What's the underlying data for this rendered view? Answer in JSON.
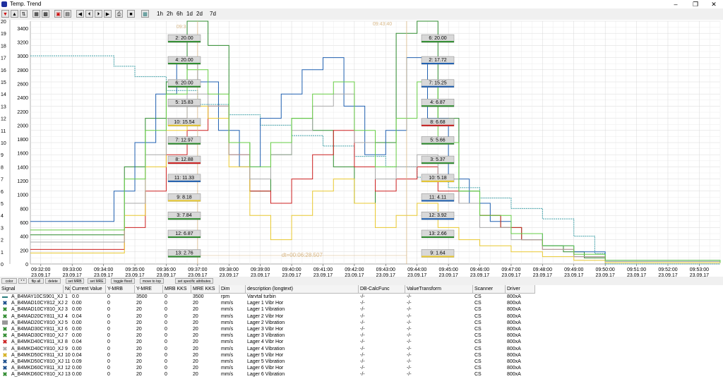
{
  "window": {
    "title": "Temp. Trend"
  },
  "toolbar": {
    "ranges": [
      "1h",
      "2h",
      "6h",
      "1d",
      "2d",
      "7d"
    ]
  },
  "chart_data": {
    "type": "line",
    "x_ticks": [
      {
        "time": "09:32:00",
        "date": "23.09.17"
      },
      {
        "time": "09:33:00",
        "date": "23.09.17"
      },
      {
        "time": "09:34:00",
        "date": "23.09.17"
      },
      {
        "time": "09:35:00",
        "date": "23.09.17"
      },
      {
        "time": "09:36:00",
        "date": "23.09.17"
      },
      {
        "time": "09:37:00",
        "date": "23.09.17"
      },
      {
        "time": "09:38:00",
        "date": "23.09.17"
      },
      {
        "time": "09:39:00",
        "date": "23.09.17"
      },
      {
        "time": "09:40:00",
        "date": "23.09.17"
      },
      {
        "time": "09:41:00",
        "date": "23.09.17"
      },
      {
        "time": "09:42:00",
        "date": "23.09.17"
      },
      {
        "time": "09:43:00",
        "date": "23.09.17"
      },
      {
        "time": "09:44:00",
        "date": "23.09.17"
      },
      {
        "time": "09:45:00",
        "date": "23.09.17"
      },
      {
        "time": "09:46:00",
        "date": "23.09.17"
      },
      {
        "time": "09:47:00",
        "date": "23.09.17"
      },
      {
        "time": "09:48:00",
        "date": "23.09.17"
      },
      {
        "time": "09:49:00",
        "date": "23.09.17"
      },
      {
        "time": "09:50:00",
        "date": "23.09.17"
      },
      {
        "time": "09:51:00",
        "date": "23.09.17"
      },
      {
        "time": "09:52:00",
        "date": "23.09.17"
      },
      {
        "time": "09:53:00",
        "date": "23.09.17"
      }
    ],
    "xlim": [
      "09:31:40",
      "09:53:40"
    ],
    "y_left_ticks": [
      "20",
      "19",
      "18",
      "17",
      "16",
      "15",
      "14",
      "13",
      "12",
      "11",
      "10",
      "9",
      "8",
      "7",
      "6",
      "5",
      "4",
      "3",
      "2",
      "1",
      "0"
    ],
    "y_left_lim": [
      0,
      20
    ],
    "y_right_ticks": [
      "3400",
      "3200",
      "3000",
      "2800",
      "2600",
      "2400",
      "2200",
      "2000",
      "1800",
      "1600",
      "1400",
      "1200",
      "1000",
      "800",
      "600",
      "400",
      "200",
      "0"
    ],
    "y_right_lim": [
      0,
      3500
    ],
    "grid": true,
    "cursor1": {
      "time": "09:37:00",
      "label": "09:3",
      "date_label": "23.09.17"
    },
    "cursor2": {
      "time": "09:43:40",
      "label": "09:43:40",
      "date_label": "23.09.17"
    },
    "delta_label": "dt=00:06:28.507",
    "cursor1_labels": [
      {
        "text": "2: 20.00",
        "color": "#2e8b2e",
        "value": 18.6
      },
      {
        "text": "4: 20.00",
        "color": "#2e8b2e",
        "value": 16.8
      },
      {
        "text": "6: 20.00",
        "color": "#2e8b2e",
        "value": 14.9
      },
      {
        "text": "5: 15.83",
        "color": "#aaaaaa",
        "value": 13.3
      },
      {
        "text": "10: 15.54",
        "color": "#e8c830",
        "value": 11.7
      },
      {
        "text": "7: 12.97",
        "color": "#2e8b2e",
        "value": 10.2
      },
      {
        "text": "8: 12.88",
        "color": "#cc2020",
        "value": 8.6
      },
      {
        "text": "11: 11.33",
        "color": "#2060b0",
        "value": 7.1
      },
      {
        "text": "9: 8.18",
        "color": "#e8c830",
        "value": 5.5
      },
      {
        "text": "3: 7.84",
        "color": "#2e8b2e",
        "value": 4.0
      },
      {
        "text": "12: 6.87",
        "color": "#2e8b2e",
        "value": 2.5
      },
      {
        "text": "13: 2.76",
        "color": "#2e8b2e",
        "value": 0.9
      }
    ],
    "cursor2_labels": [
      {
        "text": "6: 20.00",
        "color": "#2e8b2e",
        "value": 18.6
      },
      {
        "text": "2: 17.72",
        "color": "#2060b0",
        "value": 16.8
      },
      {
        "text": "7: 15.25",
        "color": "#2060b0",
        "value": 14.9
      },
      {
        "text": "4: 6.87",
        "color": "#2e8b2e",
        "value": 13.3
      },
      {
        "text": "8: 6.68",
        "color": "#cc2020",
        "value": 11.7
      },
      {
        "text": "5: 5.66",
        "color": "#2e8b2e",
        "value": 10.2
      },
      {
        "text": "3: 5.37",
        "color": "#2e8b2e",
        "value": 8.6
      },
      {
        "text": "10: 5.18",
        "color": "#e8c830",
        "value": 7.1
      },
      {
        "text": "11: 4.11",
        "color": "#2060b0",
        "value": 5.5
      },
      {
        "text": "12: 3.92",
        "color": "#2060b0",
        "value": 4.0
      },
      {
        "text": "13: 2.66",
        "color": "#2e8b2e",
        "value": 2.5
      },
      {
        "text": "9: 1.64",
        "color": "#e8c830",
        "value": 0.9
      }
    ],
    "series": [
      {
        "color": "#40a0a8",
        "dashed": true,
        "scale": "right",
        "x": [
          "09:31:40",
          "09:34:00",
          "09:34:20",
          "09:35:00",
          "09:36:00",
          "09:37:00",
          "09:38:00",
          "09:39:00",
          "09:40:00",
          "09:41:00",
          "09:42:00",
          "09:43:00",
          "09:44:00",
          "09:45:00",
          "09:46:00",
          "09:47:00",
          "09:48:00",
          "09:49:00",
          "09:49:40",
          "09:50:00",
          "09:53:40"
        ],
        "y": [
          3000,
          3000,
          2850,
          2700,
          2500,
          2300,
          2150,
          2000,
          1850,
          1700,
          1550,
          1400,
          1250,
          1100,
          950,
          800,
          650,
          400,
          150,
          0,
          0
        ]
      },
      {
        "color": "#2e8b2e",
        "scale": "left",
        "x": [
          "09:31:40",
          "09:34:00",
          "09:34:40",
          "09:35:20",
          "09:36:00",
          "09:36:40",
          "09:37:20",
          "09:38:00",
          "09:38:40",
          "09:39:20",
          "09:40:00",
          "09:40:40",
          "09:41:20",
          "09:42:00",
          "09:42:40",
          "09:43:20",
          "09:44:00",
          "09:44:40",
          "09:45:20",
          "09:46:00",
          "09:46:40",
          "09:47:20",
          "09:48:00",
          "09:48:40",
          "09:49:20",
          "09:50:00",
          "09:53:40"
        ],
        "y": [
          2.4,
          2.4,
          8,
          12,
          15,
          20,
          18,
          10,
          6,
          9,
          12,
          11,
          8,
          5,
          10,
          19,
          20,
          12,
          6,
          4,
          3,
          2,
          1.5,
          1,
          0.5,
          0.2,
          0.1
        ]
      },
      {
        "color": "#2060b0",
        "scale": "left",
        "x": [
          "09:31:40",
          "09:33:40",
          "09:34:20",
          "09:35:00",
          "09:35:40",
          "09:36:20",
          "09:37:00",
          "09:37:40",
          "09:38:20",
          "09:39:00",
          "09:39:40",
          "09:40:20",
          "09:41:00",
          "09:41:40",
          "09:42:20",
          "09:43:00",
          "09:43:40",
          "09:44:20",
          "09:45:00",
          "09:45:40",
          "09:46:20",
          "09:47:00",
          "09:48:00",
          "09:49:00",
          "09:50:00",
          "09:53:40"
        ],
        "y": [
          3.5,
          3.5,
          6,
          10,
          14,
          17,
          15,
          11,
          8,
          12,
          14,
          16,
          17,
          13,
          9,
          11,
          17,
          12,
          7,
          5,
          3.5,
          2.5,
          1.5,
          1,
          0.3,
          0.1
        ]
      },
      {
        "color": "#cc2020",
        "scale": "left",
        "x": [
          "09:31:40",
          "09:34:00",
          "09:34:40",
          "09:35:20",
          "09:36:00",
          "09:36:40",
          "09:37:20",
          "09:38:00",
          "09:38:40",
          "09:39:20",
          "09:40:00",
          "09:40:40",
          "09:41:20",
          "09:42:00",
          "09:42:40",
          "09:43:20",
          "09:44:00",
          "09:44:40",
          "09:45:20",
          "09:46:00",
          "09:46:40",
          "09:47:20",
          "09:48:00",
          "09:49:00",
          "09:50:00",
          "09:53:40"
        ],
        "y": [
          1.2,
          1.2,
          3,
          6,
          9,
          11,
          13,
          9,
          6,
          5,
          7,
          9,
          11,
          8,
          6,
          7,
          8,
          6,
          5,
          4,
          3,
          2,
          1.2,
          0.6,
          0.2,
          0.1
        ]
      },
      {
        "color": "#e8c830",
        "scale": "left",
        "x": [
          "09:31:40",
          "09:34:00",
          "09:34:40",
          "09:35:20",
          "09:36:00",
          "09:36:40",
          "09:37:20",
          "09:38:00",
          "09:38:40",
          "09:39:20",
          "09:40:00",
          "09:40:40",
          "09:41:20",
          "09:42:00",
          "09:42:40",
          "09:43:20",
          "09:44:00",
          "09:44:40",
          "09:45:20",
          "09:46:00",
          "09:47:00",
          "09:48:00",
          "09:49:00",
          "09:50:00",
          "09:53:40"
        ],
        "y": [
          0.9,
          0.9,
          4,
          8,
          11,
          13,
          12,
          8,
          4,
          2,
          4,
          6,
          7,
          5,
          3,
          4,
          5,
          3,
          2,
          1.5,
          1,
          0.6,
          0.3,
          0.1,
          0.1
        ]
      },
      {
        "color": "#aaaaaa",
        "scale": "left",
        "x": [
          "09:31:40",
          "09:34:00",
          "09:34:40",
          "09:35:20",
          "09:36:00",
          "09:36:40",
          "09:37:20",
          "09:38:00",
          "09:38:40",
          "09:39:20",
          "09:40:00",
          "09:40:40",
          "09:41:20",
          "09:42:00",
          "09:42:40",
          "09:43:20",
          "09:44:00",
          "09:44:40",
          "09:45:20",
          "09:46:00",
          "09:47:00",
          "09:48:00",
          "09:49:00",
          "09:50:00",
          "09:53:40"
        ],
        "y": [
          1.8,
          1.8,
          5,
          9,
          12,
          14,
          13,
          9,
          7,
          9,
          11,
          13,
          14,
          10,
          7,
          8,
          9,
          7,
          5,
          3,
          2,
          1.2,
          0.6,
          0.2,
          0.1
        ]
      },
      {
        "color": "#66cc44",
        "scale": "left",
        "x": [
          "09:31:40",
          "09:34:00",
          "09:34:40",
          "09:35:20",
          "09:36:00",
          "09:36:40",
          "09:37:20",
          "09:38:00",
          "09:38:40",
          "09:39:20",
          "09:40:00",
          "09:40:40",
          "09:41:20",
          "09:42:00",
          "09:42:40",
          "09:43:20",
          "09:44:00",
          "09:44:40",
          "09:45:20",
          "09:46:00",
          "09:47:00",
          "09:48:00",
          "09:49:00",
          "09:50:00",
          "09:53:40"
        ],
        "y": [
          2.8,
          2.8,
          7,
          11,
          14,
          16,
          14,
          10,
          8,
          10,
          12,
          14,
          15,
          11,
          8,
          12,
          15,
          10,
          6,
          4,
          2.5,
          1.5,
          0.8,
          0.3,
          0.1
        ]
      }
    ]
  },
  "controls": {
    "color": "color",
    "more": "* *",
    "flip_all": "flip all",
    "delete": "delete",
    "set_mrb": "set MRB",
    "set_mre": "set MRE",
    "toggle_flood": "toggle flood",
    "move_to_top": "move to top",
    "set_specific": "set specific attributes"
  },
  "table": {
    "headers": [
      "Signal",
      "No",
      "Current Value",
      "Y-MRB",
      "Y-MRE",
      "MRB KKS",
      "MRE KKS",
      "Dim",
      "description (longtext)",
      "DB-CalcFunc",
      "ValueTransform",
      "Scanner",
      "Driver"
    ],
    "rows": [
      {
        "icon": "line",
        "color": "#2a7c7c",
        "signal": "A_B4MAY10CS901_XJ",
        "no": "1",
        "current": "0.0",
        "mrb": "0",
        "mre": "3500",
        "mrbkks": "0",
        "mrekks": "3500",
        "dim": "rpm",
        "desc": "Varvtal turbin",
        "calc": "-/-",
        "vt": "-/-",
        "scanner": "CS",
        "driver": "800xA"
      },
      {
        "icon": "x",
        "color": "#1a4d8c",
        "signal": "A_B4MAD10CY812_XJ",
        "no": "2",
        "current": "0.00",
        "mrb": "0",
        "mre": "20",
        "mrbkks": "0",
        "mrekks": "20",
        "dim": "mm/s",
        "desc": "Lager 1 Vibr Hor",
        "calc": "-/-",
        "vt": "-/-",
        "scanner": "CS",
        "driver": "800xA"
      },
      {
        "icon": "x",
        "color": "#2e8b2e",
        "signal": "A_B4MAD10CY810_XJ",
        "no": "3",
        "current": "0.00",
        "mrb": "0",
        "mre": "20",
        "mrbkks": "0",
        "mrekks": "20",
        "dim": "mm/s",
        "desc": "Lager 1 Vibration",
        "calc": "-/-",
        "vt": "-/-",
        "scanner": "CS",
        "driver": "800xA"
      },
      {
        "icon": "x",
        "color": "#2e8b2e",
        "signal": "A_B4MAD20CY811_XJ",
        "no": "4",
        "current": "0.04",
        "mrb": "0",
        "mre": "20",
        "mrbkks": "0",
        "mrekks": "20",
        "dim": "mm/s",
        "desc": "Lager 2 Vibr Hor",
        "calc": "-/-",
        "vt": "-/-",
        "scanner": "CS",
        "driver": "800xA"
      },
      {
        "icon": "box",
        "color": "#999999",
        "signal": "A_B4MAD20CY810_XJ",
        "no": "5",
        "current": "0.00",
        "mrb": "0",
        "mre": "20",
        "mrbkks": "0",
        "mrekks": "20",
        "dim": "mm/s",
        "desc": "Lager 2 Vibration",
        "calc": "-/-",
        "vt": "-/-",
        "scanner": "CS",
        "driver": "800xA"
      },
      {
        "icon": "x",
        "color": "#2e8b2e",
        "signal": "A_B4MAD30CY811_XJ",
        "no": "6",
        "current": "0.00",
        "mrb": "0",
        "mre": "20",
        "mrbkks": "0",
        "mrekks": "20",
        "dim": "mm/s",
        "desc": "Lager 3 Vibr Hor",
        "calc": "-/-",
        "vt": "-/-",
        "scanner": "CS",
        "driver": "800xA"
      },
      {
        "icon": "x",
        "color": "#2e8b2e",
        "signal": "A_B4MAD30CY810_XJ",
        "no": "7",
        "current": "0.00",
        "mrb": "0",
        "mre": "20",
        "mrbkks": "0",
        "mrekks": "20",
        "dim": "mm/s",
        "desc": "Lager 3 Vibration",
        "calc": "-/-",
        "vt": "-/-",
        "scanner": "CS",
        "driver": "800xA"
      },
      {
        "icon": "x",
        "color": "#cc2020",
        "signal": "A_B4MKD40CY811_XJ",
        "no": "8",
        "current": "0.04",
        "mrb": "0",
        "mre": "20",
        "mrbkks": "0",
        "mrekks": "20",
        "dim": "mm/s",
        "desc": "Lager 4 Vibr Hor",
        "calc": "-/-",
        "vt": "-/-",
        "scanner": "CS",
        "driver": "800xA"
      },
      {
        "icon": "x",
        "color": "#aaaaaa",
        "signal": "A_B4MKD40CY810_XJ",
        "no": "9",
        "current": "0.00",
        "mrb": "0",
        "mre": "20",
        "mrbkks": "0",
        "mrekks": "20",
        "dim": "mm/s",
        "desc": "Lager 4 Vibration",
        "calc": "-/-",
        "vt": "-/-",
        "scanner": "CS",
        "driver": "800xA"
      },
      {
        "icon": "x",
        "color": "#d4b020",
        "signal": "A_B4MKD50CY811_XJ",
        "no": "10",
        "current": "0.04",
        "mrb": "0",
        "mre": "20",
        "mrbkks": "0",
        "mrekks": "20",
        "dim": "mm/s",
        "desc": "Lager 5 Vibr Hor",
        "calc": "-/-",
        "vt": "-/-",
        "scanner": "CS",
        "driver": "800xA"
      },
      {
        "icon": "x",
        "color": "#1a4d8c",
        "signal": "A_B4MKD50CY810_XJ",
        "no": "11",
        "current": "0.09",
        "mrb": "0",
        "mre": "20",
        "mrbkks": "0",
        "mrekks": "20",
        "dim": "mm/s",
        "desc": "Lager 5 Vibration",
        "calc": "-/-",
        "vt": "-/-",
        "scanner": "CS",
        "driver": "800xA"
      },
      {
        "icon": "x",
        "color": "#1a4d8c",
        "signal": "A_B4MKD60CY811_XJ",
        "no": "12",
        "current": "0.00",
        "mrb": "0",
        "mre": "20",
        "mrbkks": "0",
        "mrekks": "20",
        "dim": "mm/s",
        "desc": "Lager 6 Vibr Hor",
        "calc": "-/-",
        "vt": "-/-",
        "scanner": "CS",
        "driver": "800xA"
      },
      {
        "icon": "x",
        "color": "#2e8b2e",
        "signal": "A_B4MKD60CY810_XJ",
        "no": "13",
        "current": "0.00",
        "mrb": "0",
        "mre": "20",
        "mrbkks": "0",
        "mrekks": "20",
        "dim": "mm/s",
        "desc": "Lager 6 Vibration",
        "calc": "-/-",
        "vt": "-/-",
        "scanner": "CS",
        "driver": "800xA"
      }
    ]
  }
}
